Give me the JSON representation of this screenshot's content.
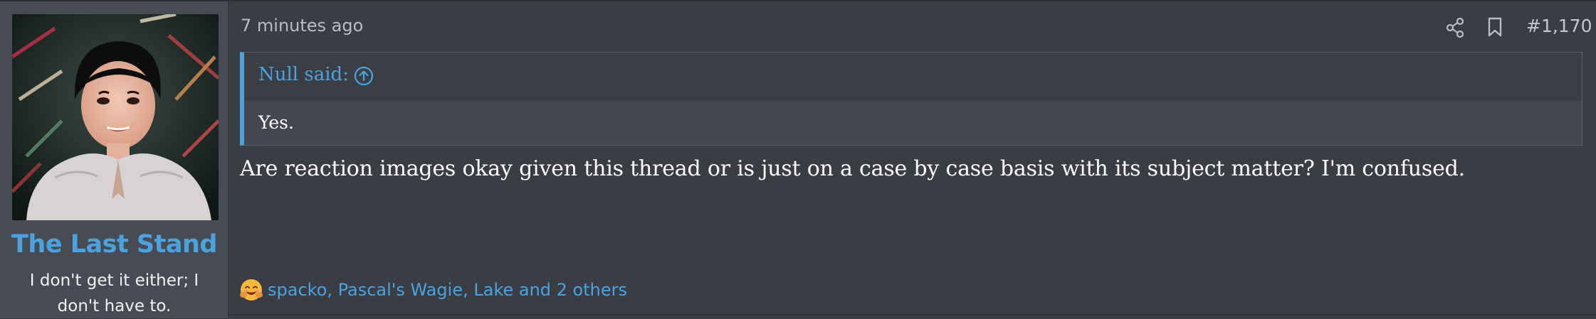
{
  "post": {
    "author": {
      "username": "The Last Stand",
      "user_title": "I don't get it either; I don't have to."
    },
    "timestamp": "7 minutes ago",
    "post_number": "#1,170",
    "quote": {
      "author_label": "Null said:",
      "text": "Yes."
    },
    "message": "Are reaction images okay given this thread or is just on a case by case basis with its subject matter? I'm confused.",
    "reactions": {
      "icon": "hugging-face-emoji",
      "summary": "spacko, Pascal's Wagie, Lake and 2 others"
    }
  },
  "icons": {
    "share": "share-icon",
    "bookmark": "bookmark-icon",
    "quote_expand": "arrow-up-circle-icon"
  },
  "colors": {
    "accent": "#4aa3df",
    "background": "#3a3d44",
    "sidebar": "#474b54"
  }
}
